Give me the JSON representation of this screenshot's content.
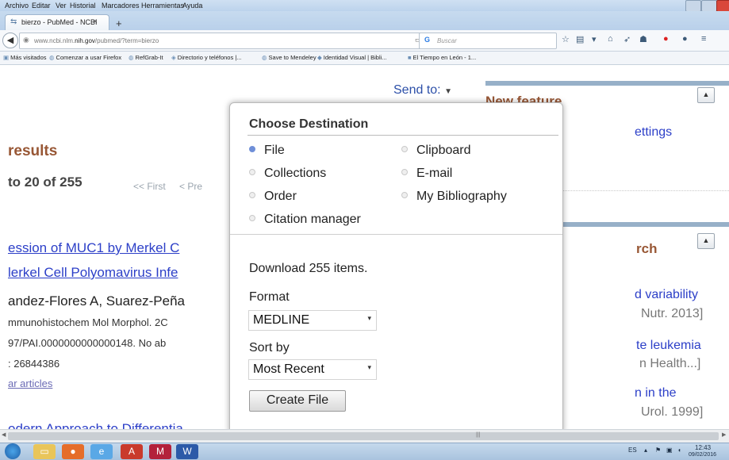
{
  "menu": [
    "Archivo",
    "Editar",
    "Ver",
    "Historial",
    "Marcadores",
    "Herramientas",
    "Ayuda"
  ],
  "tab": {
    "title": "bierzo - PubMed - NCBI",
    "close": "×",
    "new_tab": "+"
  },
  "nav": {
    "url_prefix": "www.ncbi.nlm.",
    "url_host": "nih.gov",
    "url_suffix": "/pubmed/?term=bierzo",
    "search_placeholder": "Buscar"
  },
  "bookmarks": [
    "Más visitados",
    "Comenzar a usar Firefox",
    "RefGrab-It",
    "Directorio y teléfonos |...",
    "Save to Mendeley",
    "Identidad Visual | Bibli...",
    "El Tiempo en León - 1..."
  ],
  "page": {
    "results_title": "results",
    "results_range": "to 20 of 255",
    "pager_first": "<< First",
    "pager_prev": "< Pre",
    "send_to": "Send to:",
    "results": [
      {
        "title": "ession of MUC1 by Merkel C"
      },
      {
        "title": "lerkel Cell Polyomavirus Infe"
      },
      {
        "authors": "andez-Flores A, Suarez-Peña"
      },
      {
        "meta": "mmunohistochem Mol Morphol. 2C"
      },
      {
        "meta": "97/PAI.0000000000000148. No ab"
      },
      {
        "meta": ": 26844386"
      },
      {
        "link": "ar articles"
      },
      {
        "title": "odern Approach to Differentia"
      }
    ]
  },
  "right": {
    "new_feature": "New feature",
    "settings_text": "ettings",
    "search_title": "rch",
    "items": [
      {
        "text": "d variability",
        "meta": "Nutr. 2013]"
      },
      {
        "text": "te leukemia",
        "meta": "n Health...]"
      },
      {
        "text": "n in the",
        "meta": "Urol. 1999]"
      }
    ]
  },
  "popup": {
    "title": "Choose Destination",
    "destinations": [
      {
        "label": "File",
        "selected": true
      },
      {
        "label": "Clipboard",
        "selected": false
      },
      {
        "label": "Collections",
        "selected": false
      },
      {
        "label": "E-mail",
        "selected": false
      },
      {
        "label": "Order",
        "selected": false
      },
      {
        "label": "My Bibliography",
        "selected": false
      },
      {
        "label": "Citation manager",
        "selected": false
      }
    ],
    "download_text": "Download 255 items.",
    "format_label": "Format",
    "format_value": "MEDLINE",
    "sort_label": "Sort by",
    "sort_value": "Most Recent",
    "create_button": "Create File"
  },
  "taskbar": {
    "apps": [
      "chrome",
      "explorer",
      "firefox",
      "ie",
      "acrobat",
      "mendeley",
      "word"
    ],
    "lang": "ES",
    "time": "12:43",
    "date": "09/02/2016"
  },
  "colors": {
    "link_blue": "#2c3fc8",
    "heading_brown": "#985735",
    "radio_selected": "#6f8fd8"
  }
}
